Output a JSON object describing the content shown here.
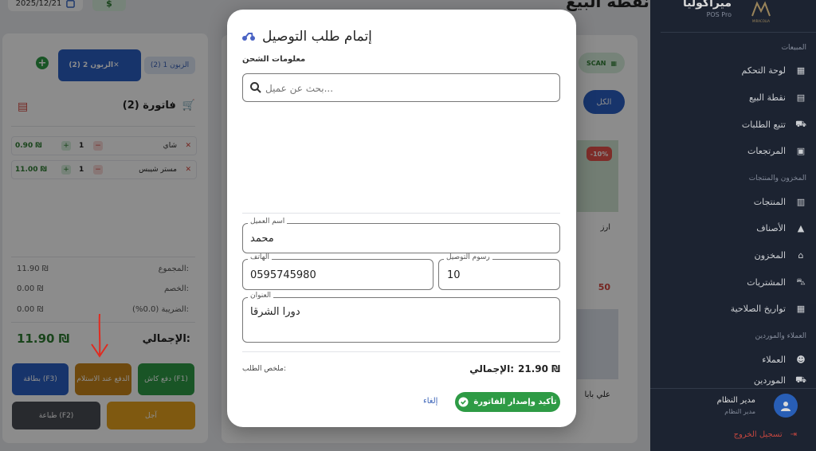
{
  "sidebar": {
    "brand_name": "ميراكوليا",
    "brand_sub": "POS Pro",
    "logo_text": "MIRACOLIA",
    "sections": {
      "sales": "المبيعات",
      "inventory": "المخزون والمنتجات",
      "clients": "العملاء والموردين"
    },
    "items": [
      {
        "label": "لوحة التحكم",
        "icon": "dashboard-icon"
      },
      {
        "label": "نقطة البيع",
        "icon": "register-icon"
      },
      {
        "label": "تتبع الطلبات",
        "icon": "delivery-icon"
      },
      {
        "label": "المرتجعات",
        "icon": "return-box-icon"
      },
      {
        "label": "المنتجات",
        "icon": "archive-icon"
      },
      {
        "label": "الأصناف",
        "icon": "shapes-icon"
      },
      {
        "label": "المخزون",
        "icon": "warehouse-icon"
      },
      {
        "label": "المشتريات",
        "icon": "cart-icon"
      },
      {
        "label": "تواريخ الصلاحية",
        "icon": "calendar-icon"
      },
      {
        "label": "العملاء",
        "icon": "people-icon"
      },
      {
        "label": "الموردين",
        "icon": "truck-icon"
      }
    ],
    "user_name": "مدير النظام",
    "user_role": "مدير النظام",
    "logout": "تسجيل الخروج"
  },
  "topbar": {
    "title": "نقطة البيع",
    "date": "2025/12/21"
  },
  "cart": {
    "customer_tab_1": "الزبون 1 (2)",
    "customer_tab_2": "الزبون 2 (2)",
    "invoice_title": "فاتورة (2)",
    "items": [
      {
        "name": "شاي",
        "qty": "1",
        "price": "0.90 ₪"
      },
      {
        "name": "مستر شيبس",
        "qty": "1",
        "price": "11.00 ₪"
      }
    ],
    "subtotal_label": "المجموع:",
    "subtotal": "11.90 ₪",
    "discount_label": "الخصم:",
    "discount": "0.00 ₪",
    "tax_label": "الضريبة (0.0%):",
    "tax": "0.00 ₪",
    "total_label": "الإجمالي:",
    "total": "11.90 ₪",
    "buttons": {
      "card": "بطاقة (F3)",
      "cod": "الدفع عند الاستلام",
      "cash": "دفع كاش (F1)",
      "print": "طباعة (F2)",
      "later": "آجل"
    },
    "colors": {
      "card": "#2b5fc4",
      "cod": "#c9851a",
      "cash": "#2e9b45",
      "print": "#4a4d55",
      "later": "#e8a21e"
    }
  },
  "products": {
    "scan": "SCAN",
    "all": "الكل",
    "discount_badge": "-10%",
    "card1_name": "ارز",
    "card1_price": "50",
    "card2_name": "علي بابا"
  },
  "modal": {
    "title": "إتمام طلب التوصيل",
    "shipping_info": "معلومات الشحن",
    "search_placeholder": "بحث عن عميل...",
    "customer_name_label": "اسم العميل",
    "customer_name": "محمد",
    "phone_label": "الهاتف",
    "phone": "0595745980",
    "fee_label": "رسوم التوصيل",
    "fee": "10",
    "address_label": "العنوان",
    "address": "دورا الشرقا",
    "summary_label": "ملخص الطلب:",
    "total_label": "الإجمالي:",
    "total": "21.90 ₪",
    "confirm": "تأكيد وإصدار الفاتورة",
    "cancel": "إلغاء"
  }
}
